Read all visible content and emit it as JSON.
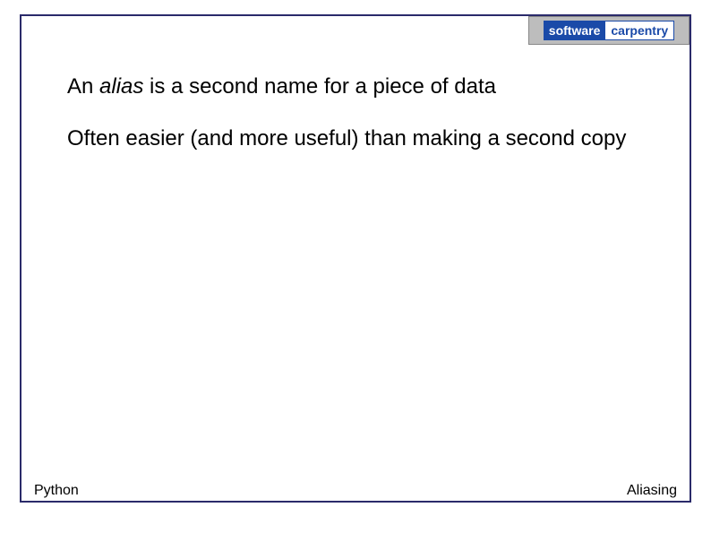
{
  "logo": {
    "left": "software",
    "right": "carpentry"
  },
  "body": {
    "line1_pre": "An ",
    "line1_em": "alias",
    "line1_post": " is a second name for a piece of data",
    "line2": "Often easier (and more useful) than making a second copy"
  },
  "footer": {
    "left": "Python",
    "right": "Aliasing"
  }
}
